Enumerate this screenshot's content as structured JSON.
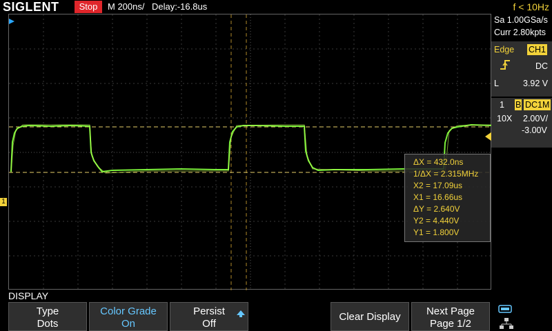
{
  "header": {
    "brand": "SIGLENT",
    "run_state": "Stop",
    "timebase": "M 200ns/",
    "delay": "Delay:-16.8us",
    "frequency": "f < 10Hz"
  },
  "acquisition": {
    "sample_rate": "Sa 1.00GSa/s",
    "memory": "Curr 2.80kpts"
  },
  "trigger": {
    "type": "Edge",
    "source": "CH1",
    "coupling": "DC",
    "level_label": "L",
    "level": "3.92 V"
  },
  "channel1": {
    "number": "1",
    "impedance_badge": "B",
    "coupling": "DC1M",
    "probe": "10X",
    "scale": "2.00V/",
    "offset": "-3.00V"
  },
  "cursors": {
    "delta_x": "ΔX = 432.0ns",
    "inv_delta_x": "1/ΔX = 2.315MHz",
    "x2": "X2 = 17.09us",
    "x1": "X1 = 16.66us",
    "delta_y": "ΔY = 2.640V",
    "y2": "Y2 = 4.440V",
    "y1": "Y1 = 1.800V"
  },
  "menu": {
    "title": "DISPLAY",
    "keys": [
      {
        "line1": "Type",
        "line2": "Dots"
      },
      {
        "line1": "Color Grade",
        "line2": "On"
      },
      {
        "line1": "Persist",
        "line2": "Off"
      },
      {
        "line1": "Clear Display",
        "line2": ""
      },
      {
        "line1": "Next Page",
        "line2": "Page 1/2"
      }
    ]
  },
  "colors": {
    "trace": "#7cf23a",
    "accent": "#f2d23a",
    "stop": "#e0262b",
    "active": "#66c7ff"
  },
  "icons": [
    "channel1-ground-marker",
    "trigger-position-marker",
    "trigger-level-marker",
    "rising-edge-icon",
    "arrow-up-icon",
    "usb-icon",
    "network-icon"
  ]
}
